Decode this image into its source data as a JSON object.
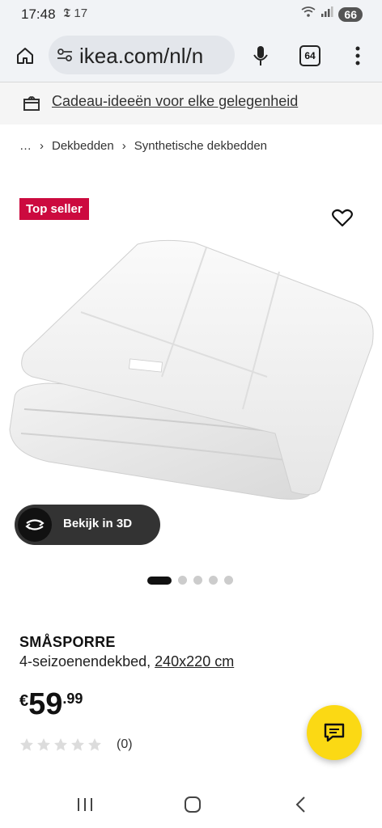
{
  "status": {
    "time": "17:48",
    "notif_text": "𝕿 17",
    "battery": "66"
  },
  "browser": {
    "url": "ikea.com/nl/n",
    "tab_count": "64"
  },
  "promo": {
    "label": "Cadeau-ideeën voor elke gelegenheid"
  },
  "breadcrumb": {
    "items": [
      "…",
      "Dekbedden",
      "Synthetische dekbedden"
    ]
  },
  "product": {
    "badge": "Top seller",
    "name": "SMÅSPORRE",
    "description": "4-seizoenendekbed,",
    "size": "240x220 cm",
    "price": {
      "currency": "€",
      "integer": "59",
      "decimal": ".99"
    },
    "rating": {
      "stars": 0,
      "count": "(0)"
    },
    "view3d_label": "Bekijk in 3D"
  },
  "gallery": {
    "image_count": 5,
    "active_index": 0
  },
  "colors": {
    "badge": "#cc0a3f",
    "chat": "#fbd914"
  }
}
